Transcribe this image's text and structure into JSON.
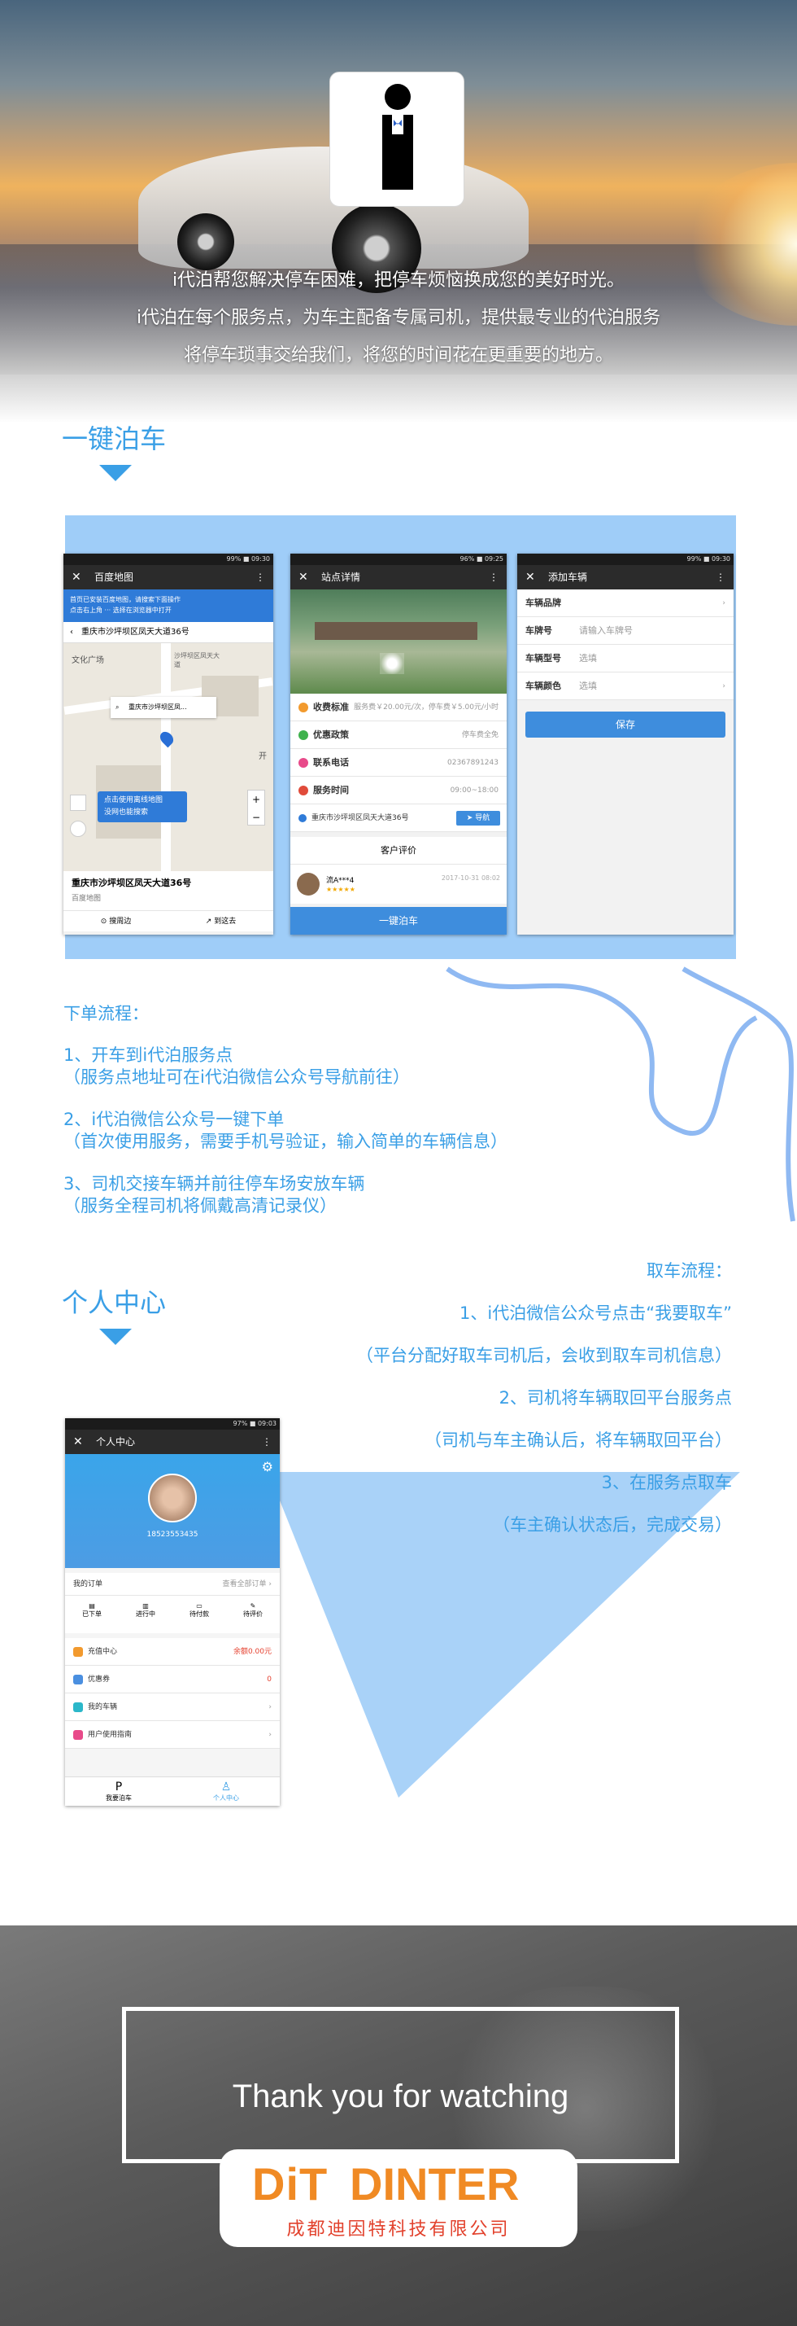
{
  "hero": {
    "lines": [
      "i代泊帮您解决停车困难，把停车烦恼换成您的美好时光。",
      "i代泊在每个服务点，为车主配备专属司机，提供最专业的代泊服务",
      "将停车琐事交给我们，将您的时间花在更重要的地方。"
    ]
  },
  "section1": {
    "title": "一键泊车"
  },
  "phone1": {
    "status": "99% ■ 09:30",
    "title": "百度地图",
    "banner": "首页已安装百度地图，请搜索下面操作",
    "banner_sub": "点击右上角 ··· 选择在浏览器中打开",
    "address": "重庆市沙坪坝区凤天大道36号",
    "search_value": "重庆市沙坪坝区凤...",
    "map_labels": [
      "文化广场",
      "沙坪坝区凤天大道",
      "开"
    ],
    "tip_lines": [
      "点击使用离线地图",
      "没网也能搜索"
    ],
    "bottom_addr": "重庆市沙坪坝区凤天大道36号",
    "bottom_sub": "百度地图",
    "btn_nearby": "搜周边",
    "btn_route": "到这去"
  },
  "phone2": {
    "status": "96% ■ 09:25",
    "title": "站点详情",
    "rows": [
      {
        "k": "收费标准",
        "v": "服务费￥20.00元/次，停车费￥5.00元/小时"
      },
      {
        "k": "优惠政策",
        "v": "停车费全免"
      },
      {
        "k": "联系电话",
        "v": "02367891243"
      },
      {
        "k": "服务时间",
        "v": "09:00~18:00"
      }
    ],
    "address": "重庆市沙坪坝区凤天大道36号",
    "nav_btn": "导航",
    "review_title": "客户评价",
    "reviewer": "流A***4",
    "review_time": "2017-10-31 08:02",
    "bottom_btn": "一键泊车"
  },
  "phone3": {
    "status": "99% ■ 09:30",
    "title": "添加车辆",
    "rows": [
      {
        "k": "车辆品牌",
        "v": ""
      },
      {
        "k": "车牌号",
        "v": "请输入车牌号"
      },
      {
        "k": "车辆型号",
        "v": "选填"
      },
      {
        "k": "车辆颜色",
        "v": "选填"
      }
    ],
    "save_btn": "保存"
  },
  "order_flow": {
    "heading": "下单流程：",
    "steps": [
      "1、开车到i代泊服务点",
      "（服务点地址可在i代泊微信公众号导航前往）",
      "2、i代泊微信公众号一键下单",
      "（首次使用服务，需要手机号验证，输入简单的车辆信息）",
      "3、司机交接车辆并前往停车场安放车辆",
      "（服务全程司机将佩戴高清记录仪）"
    ]
  },
  "pickup_flow": {
    "heading": "取车流程：",
    "steps": [
      "1、i代泊微信公众号点击“我要取车”",
      "（平台分配好取车司机后，会收到取车司机信息）",
      "2、司机将车辆取回平台服务点",
      "（司机与车主确认后，将车辆取回平台）",
      "3、在服务点取车",
      "（车主确认状态后，完成交易）"
    ]
  },
  "section2": {
    "title": "个人中心"
  },
  "phone4": {
    "status": "97% ■ 09:03",
    "title": "个人中心",
    "phone": "18523553435",
    "orders_label": "我的订单",
    "orders_all": "查看全部订单",
    "order_tabs": [
      "已下单",
      "进行中",
      "待付款",
      "待评价"
    ],
    "menu": [
      {
        "label": "充值中心",
        "value": "余额0.00元",
        "color": "#f29a2e"
      },
      {
        "label": "优惠券",
        "value": "0",
        "color": "#4a8fe0"
      },
      {
        "label": "我的车辆",
        "value": "",
        "color": "#2bb7c9"
      },
      {
        "label": "用户使用指南",
        "value": "",
        "color": "#e84a8a"
      }
    ],
    "nav": [
      "我要泊车",
      "个人中心"
    ]
  },
  "footer": {
    "thanks": "Thank you for watching",
    "brand": "DINTER",
    "logo_mark": "DiT",
    "company": "成都迪因特科技有限公司"
  }
}
